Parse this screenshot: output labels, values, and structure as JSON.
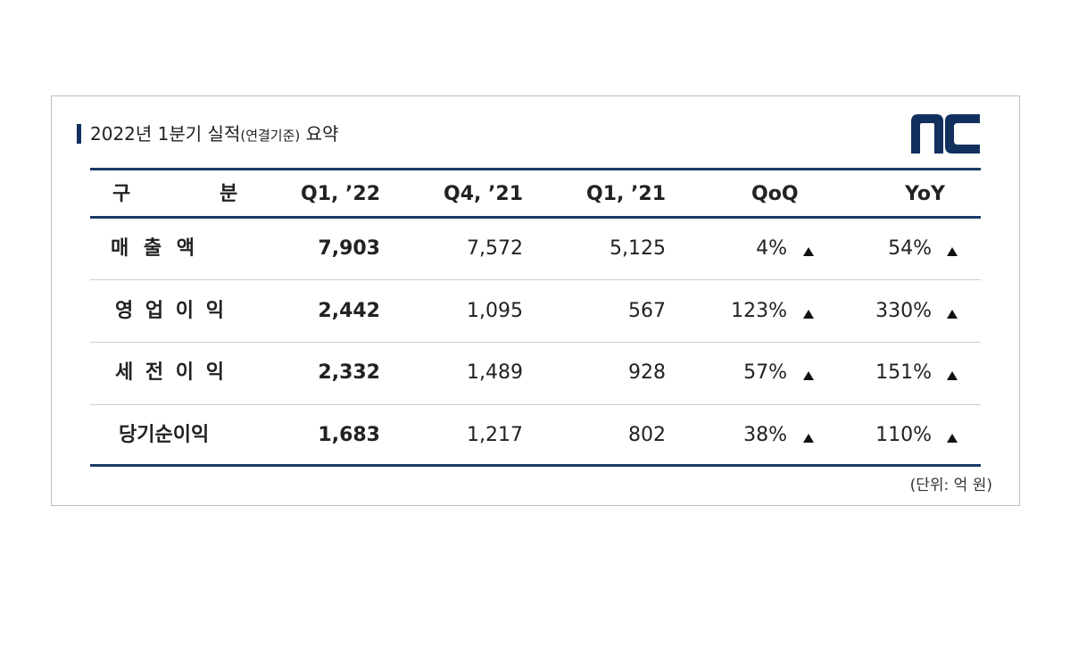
{
  "title": {
    "main": "2022년 1분기 실적",
    "sub": "(연결기준)",
    "suffix": " 요약"
  },
  "logo": {
    "text": "nc",
    "color": "#12305e"
  },
  "table": {
    "headers": {
      "label_left": "구",
      "label_right": "분",
      "c1": "Q1, ’22",
      "c2": "Q4, ’21",
      "c3": "Q1, ’21",
      "c4": "QoQ",
      "c5": "YoY"
    },
    "rows": [
      {
        "label": "매  출  액",
        "q1_22": "7,903",
        "q4_21": "7,572",
        "q1_21": "5,125",
        "qoq": "4%",
        "yoy": "54%"
      },
      {
        "label": "영 업 이 익",
        "q1_22": "2,442",
        "q4_21": "1,095",
        "q1_21": "567",
        "qoq": "123%",
        "yoy": "330%"
      },
      {
        "label": "세 전 이 익",
        "q1_22": "2,332",
        "q4_21": "1,489",
        "q1_21": "928",
        "qoq": "57%",
        "yoy": "151%"
      },
      {
        "label": "당기순이익",
        "q1_22": "1,683",
        "q4_21": "1,217",
        "q1_21": "802",
        "qoq": "38%",
        "yoy": "110%"
      }
    ],
    "trend_icon": "triangle-up-icon"
  },
  "unit_note": "(단위: 억 원)",
  "colors": {
    "accent": "#1c3a66",
    "rule": "#cfcfcf",
    "border": "#bdbdbd"
  }
}
